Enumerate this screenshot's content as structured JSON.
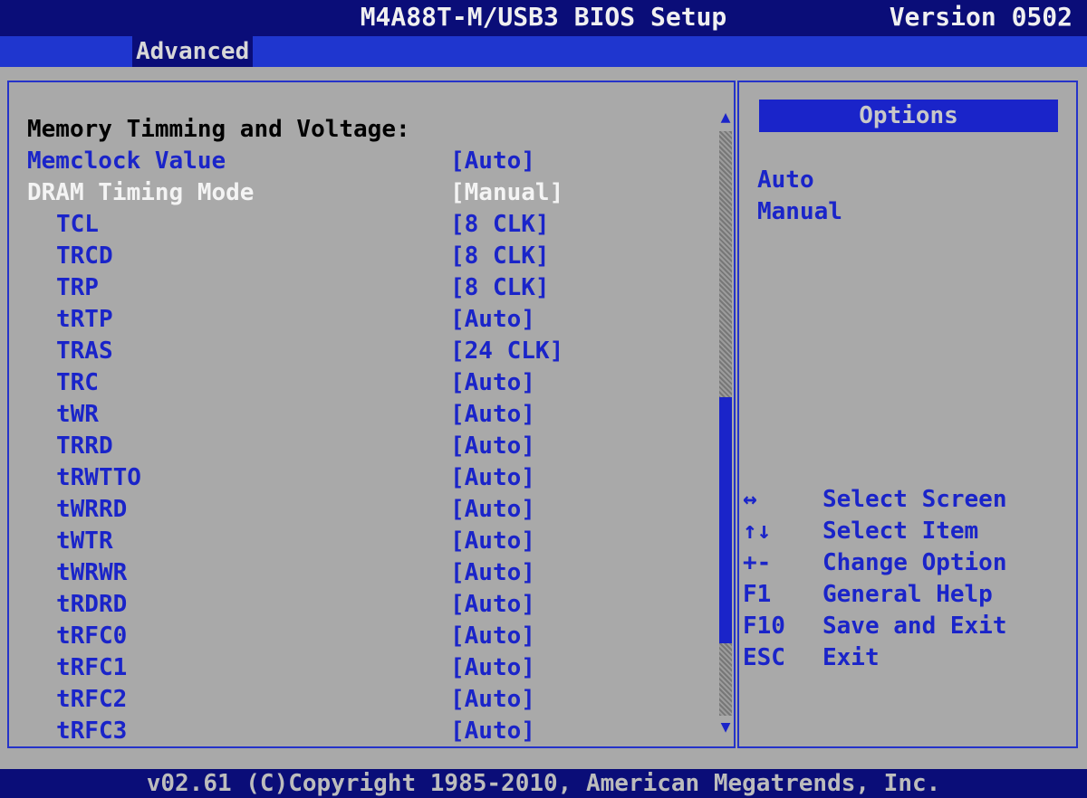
{
  "header": {
    "title": "M4A88T-M/USB3 BIOS Setup",
    "version": "Version 0502"
  },
  "menu": {
    "active_tab": "Advanced"
  },
  "settings": {
    "heading": "Memory Timming and Voltage:",
    "items": [
      {
        "label": "Memclock Value",
        "value": "[Auto]"
      },
      {
        "label": "DRAM Timing Mode",
        "value": "[Manual]"
      },
      {
        "label": "TCL",
        "value": "[8 CLK]"
      },
      {
        "label": "TRCD",
        "value": "[8 CLK]"
      },
      {
        "label": "TRP",
        "value": "[8 CLK]"
      },
      {
        "label": "tRTP",
        "value": "[Auto]"
      },
      {
        "label": "TRAS",
        "value": "[24 CLK]"
      },
      {
        "label": "TRC",
        "value": "[Auto]"
      },
      {
        "label": "tWR",
        "value": "[Auto]"
      },
      {
        "label": "TRRD",
        "value": "[Auto]"
      },
      {
        "label": "tRWTTO",
        "value": "[Auto]"
      },
      {
        "label": "tWRRD",
        "value": "[Auto]"
      },
      {
        "label": "tWTR",
        "value": "[Auto]"
      },
      {
        "label": "tWRWR",
        "value": "[Auto]"
      },
      {
        "label": "tRDRD",
        "value": "[Auto]"
      },
      {
        "label": "tRFC0",
        "value": "[Auto]"
      },
      {
        "label": "tRFC1",
        "value": "[Auto]"
      },
      {
        "label": "tRFC2",
        "value": "[Auto]"
      },
      {
        "label": "tRFC3",
        "value": "[Auto]"
      }
    ]
  },
  "scrollbar": {
    "up": "▲",
    "down": "▼"
  },
  "options": {
    "title": "Options",
    "items": [
      "Auto",
      "Manual"
    ]
  },
  "help": [
    {
      "key": "↔",
      "desc": "Select Screen"
    },
    {
      "key": "↑↓",
      "desc": "Select Item"
    },
    {
      "key": "+-",
      "desc": "Change Option"
    },
    {
      "key": "F1",
      "desc": "General Help"
    },
    {
      "key": "F10",
      "desc": "Save and Exit"
    },
    {
      "key": "ESC",
      "desc": "Exit"
    }
  ],
  "footer": {
    "copyright": "v02.61 (C)Copyright 1985-2010, American Megatrends, Inc."
  },
  "colors": {
    "accent": "#1a24c9",
    "panel_bg": "#a9a9a9",
    "header_bg": "#0a0d78",
    "selected_text": "#f4f4f4"
  }
}
